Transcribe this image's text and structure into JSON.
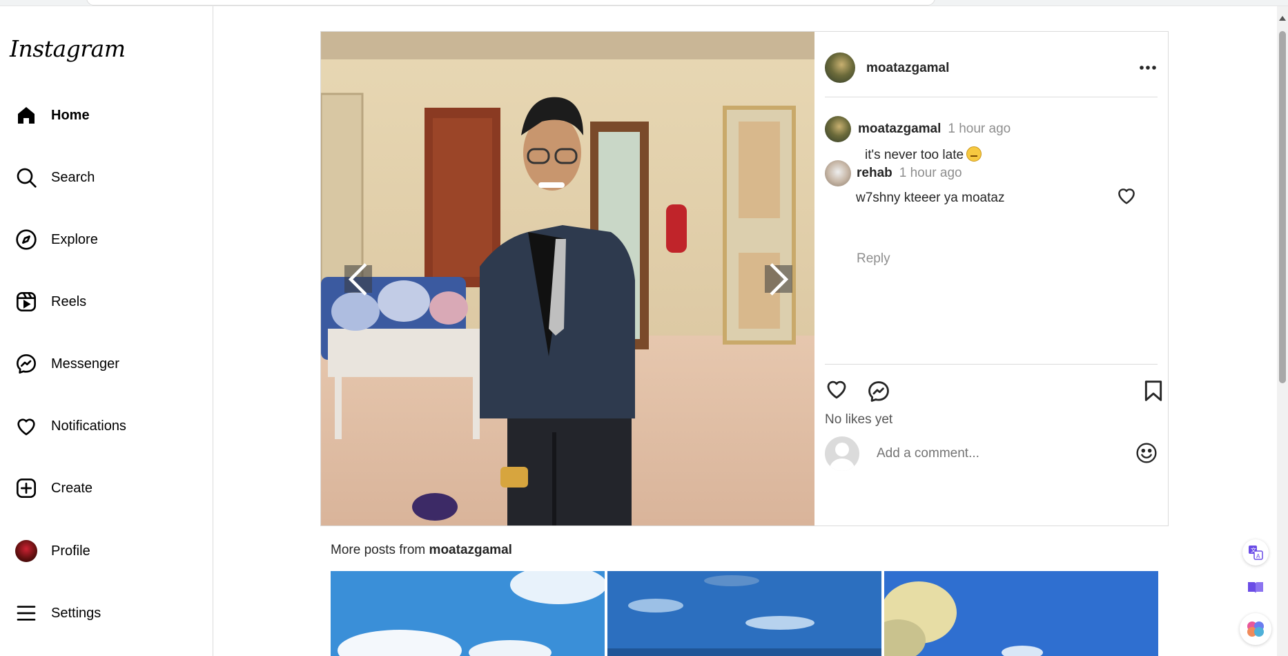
{
  "sidebar": {
    "logo": "Instagram",
    "items": [
      {
        "label": "Home",
        "icon": "home-icon",
        "active": true
      },
      {
        "label": "Search",
        "icon": "search-icon"
      },
      {
        "label": "Explore",
        "icon": "compass-icon"
      },
      {
        "label": "Reels",
        "icon": "reels-icon"
      },
      {
        "label": "Messenger",
        "icon": "messenger-icon"
      },
      {
        "label": "Notifications",
        "icon": "heart-icon"
      },
      {
        "label": "Create",
        "icon": "plus-square-icon"
      },
      {
        "label": "Profile",
        "icon": "avatar"
      },
      {
        "label": "Settings",
        "icon": "menu-icon"
      }
    ]
  },
  "post": {
    "owner": "moatazgamal",
    "comments": [
      {
        "user": "moatazgamal",
        "time": "1 hour ago",
        "text": "it's never too late",
        "emoji": "pensive-face"
      },
      {
        "user": "rehab",
        "time": "1 hour ago",
        "text": "w7shny kteeer ya moataz",
        "action": "Reply"
      }
    ],
    "likes_text": "No likes yet",
    "comment_placeholder": "Add a comment..."
  },
  "more_posts": {
    "prefix": "More posts from ",
    "user": "moatazgamal"
  },
  "colors": {
    "text": "#262626",
    "muted": "#8e8e8e",
    "border": "#dbdbdb"
  }
}
